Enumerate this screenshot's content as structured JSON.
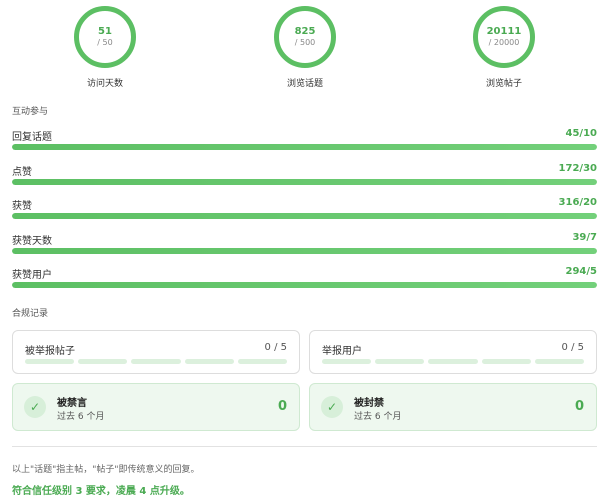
{
  "rings": [
    {
      "value": "51",
      "max": "/ 50",
      "label": "访问天数"
    },
    {
      "value": "825",
      "max": "/ 500",
      "label": "浏览话题"
    },
    {
      "value": "20111",
      "max": "/ 20000",
      "label": "浏览帖子"
    }
  ],
  "interaction": {
    "title": "互动参与",
    "bars": [
      {
        "label": "回复话题",
        "value": "45/10",
        "progress": 1.0
      },
      {
        "label": "点赞",
        "value": "172/30",
        "progress": 1.0
      },
      {
        "label": "获赞",
        "value": "316/20",
        "progress": 1.0
      },
      {
        "label": "获赞天数",
        "value": "39/7",
        "progress": 1.0
      },
      {
        "label": "获赞用户",
        "value": "294/5",
        "progress": 1.0
      }
    ]
  },
  "compliance": {
    "title": "合规记录",
    "reported_posts": {
      "label": "被举报帖子",
      "count": "0 / 5"
    },
    "reported_users": {
      "label": "举报用户",
      "count": "0 / 5"
    },
    "silenced": {
      "title": "被禁言",
      "sub": "过去 6 个月",
      "count": "0"
    },
    "suspended": {
      "title": "被封禁",
      "sub": "过去 6 个月",
      "count": "0"
    }
  },
  "footer": {
    "note": "以上\"话题\"指主帖，\"帖子\"即传统意义的回复。",
    "summary": "符合信任级别 3 要求，凌晨 4 点升级。"
  },
  "colors": {
    "accent": "#4aaa52",
    "track": "#e6f4e7"
  }
}
